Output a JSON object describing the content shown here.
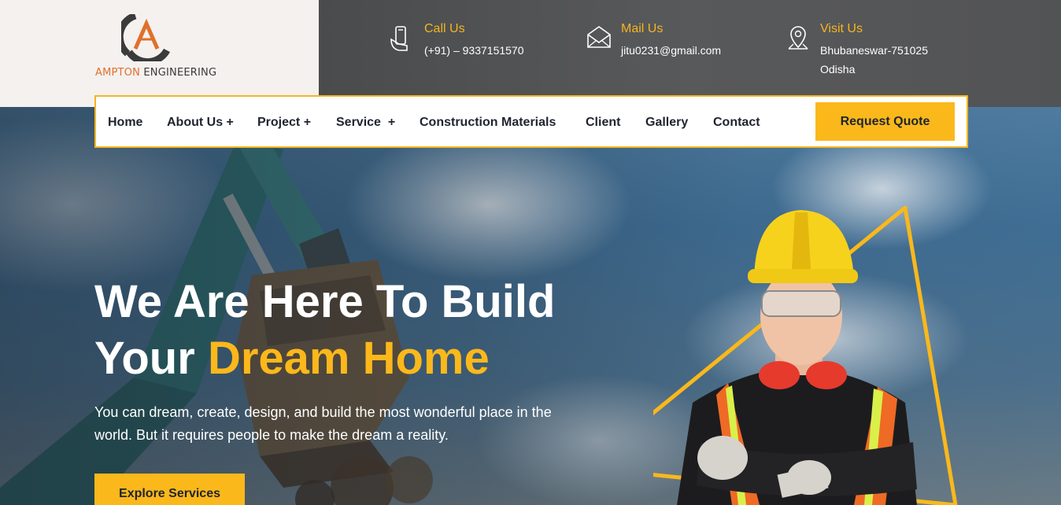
{
  "logo": {
    "part1": "AMPTON",
    "part2": " ENGINEERING"
  },
  "contacts": [
    {
      "label": "Call Us",
      "lines": [
        "(+91) – 9337151570"
      ]
    },
    {
      "label": "Mail Us",
      "lines": [
        "jitu0231@gmail.com"
      ]
    },
    {
      "label": "Visit Us",
      "lines": [
        "Bhubaneswar-751025",
        "Odisha"
      ]
    }
  ],
  "nav": {
    "items": [
      "Home",
      "About Us +",
      "Project +",
      "Service  +",
      "Construction Materials",
      "Client",
      "Gallery",
      "Contact"
    ],
    "cta": "Request Quote"
  },
  "hero": {
    "line1": "We Are Here To Build",
    "line2_plain": "Your ",
    "line2_accent": "Dream Home",
    "subtext": "You can dream, create, design, and build the most wonderful place in the world. But it requires people to make the dream a reality.",
    "button": "Explore Services"
  },
  "icons": {
    "call": "phone-hand-icon",
    "mail": "envelope-icon",
    "visit": "map-pin-icon"
  },
  "colors": {
    "accent": "#fbb81b",
    "topbar": "#525355",
    "logo_orange": "#e0702b"
  }
}
